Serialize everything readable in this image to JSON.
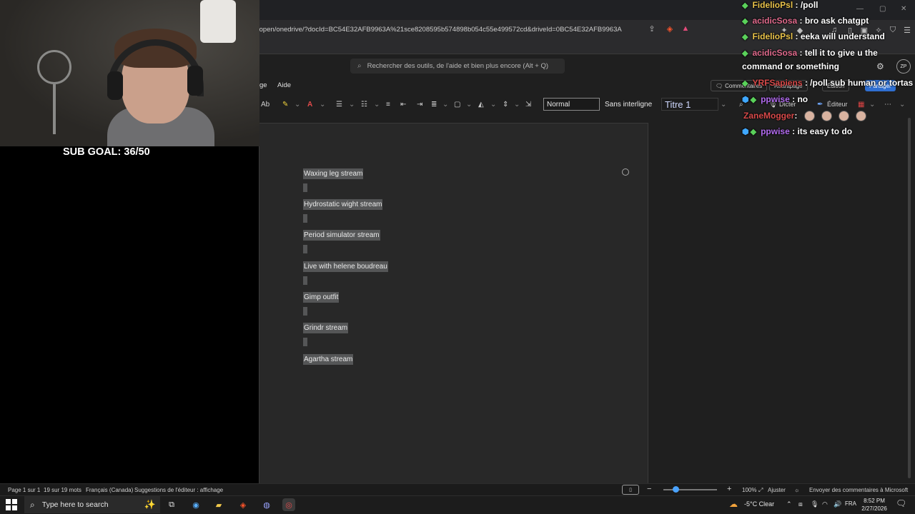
{
  "browser": {
    "url": "/open/onedrive/?docId=BC54E32AFB9963A%21sce8208595b574898b054c55e499572cd&driveId=0BC54E32AFB9963A"
  },
  "word": {
    "search_placeholder": "Rechercher des outils, de l'aide et bien plus encore (Alt + Q)",
    "menu": {
      "partial": "ge",
      "help": "Aide"
    },
    "header_buttons": {
      "comments": "Commentaires",
      "rattrapage": "Rattrapage",
      "edition": "Édition",
      "partager": "Partager"
    },
    "ribbon": {
      "styles": [
        "Normal",
        "Sans interligne",
        "Titre 1"
      ],
      "dicter": "Dicter",
      "editeur": "Éditeur",
      "font_case": "Ab"
    },
    "document_lines": [
      "Waxing leg stream",
      "Hydrostatic wight stream",
      "Period simulator stream",
      "Live with helene boudreau",
      "Gimp outfit",
      "Grindr stream",
      "Agartha stream"
    ],
    "statusbar": {
      "page": "Page 1 sur 1",
      "words": "19 sur 19 mots",
      "language": "Français (Canada)",
      "suggestions": "Suggestions de l'éditeur : affichage",
      "zoom": "100%",
      "fit": "Ajuster",
      "feedback": "Envoyer des commentaires à Microsoft"
    }
  },
  "stream": {
    "sub_goal": "SUB GOAL: 36/50",
    "chat": [
      {
        "user": "FidelioPsl",
        "message": ": /poll",
        "color": "#e8c24a"
      },
      {
        "user": "acidicSosa",
        "message": ": bro ask chatgpt",
        "color": "#e06a8c"
      },
      {
        "user": "FidelioPsl",
        "message": ": eeka will understand",
        "color": "#e8c24a"
      },
      {
        "user": "acidicSosa",
        "message": ": tell it to give u the",
        "color": "#e06a8c"
      },
      {
        "user": "",
        "message": "command or something",
        "color": "#ffffff"
      },
      {
        "user": "YRFSapiens",
        "message": ": /poll sub human or tortas",
        "color": "#d84a4a"
      },
      {
        "user": "ppwise",
        "message": ": no",
        "color": "#b36cf0"
      },
      {
        "user": "ZaneMogger",
        "message": ":",
        "color": "#d84a4a"
      },
      {
        "user": "ppwise",
        "message": ": its easy to do",
        "color": "#b36cf0"
      }
    ],
    "avatar_initials": "ZP"
  },
  "taskbar": {
    "search_placeholder": "Type here to search",
    "weather": "-5°C  Clear",
    "language": "FRA",
    "time": "8:52 PM",
    "date": "2/27/2026"
  },
  "colors": {
    "word_bg": "#1f1f1f",
    "selection": "#555657",
    "accent": "#4aa3ff"
  }
}
